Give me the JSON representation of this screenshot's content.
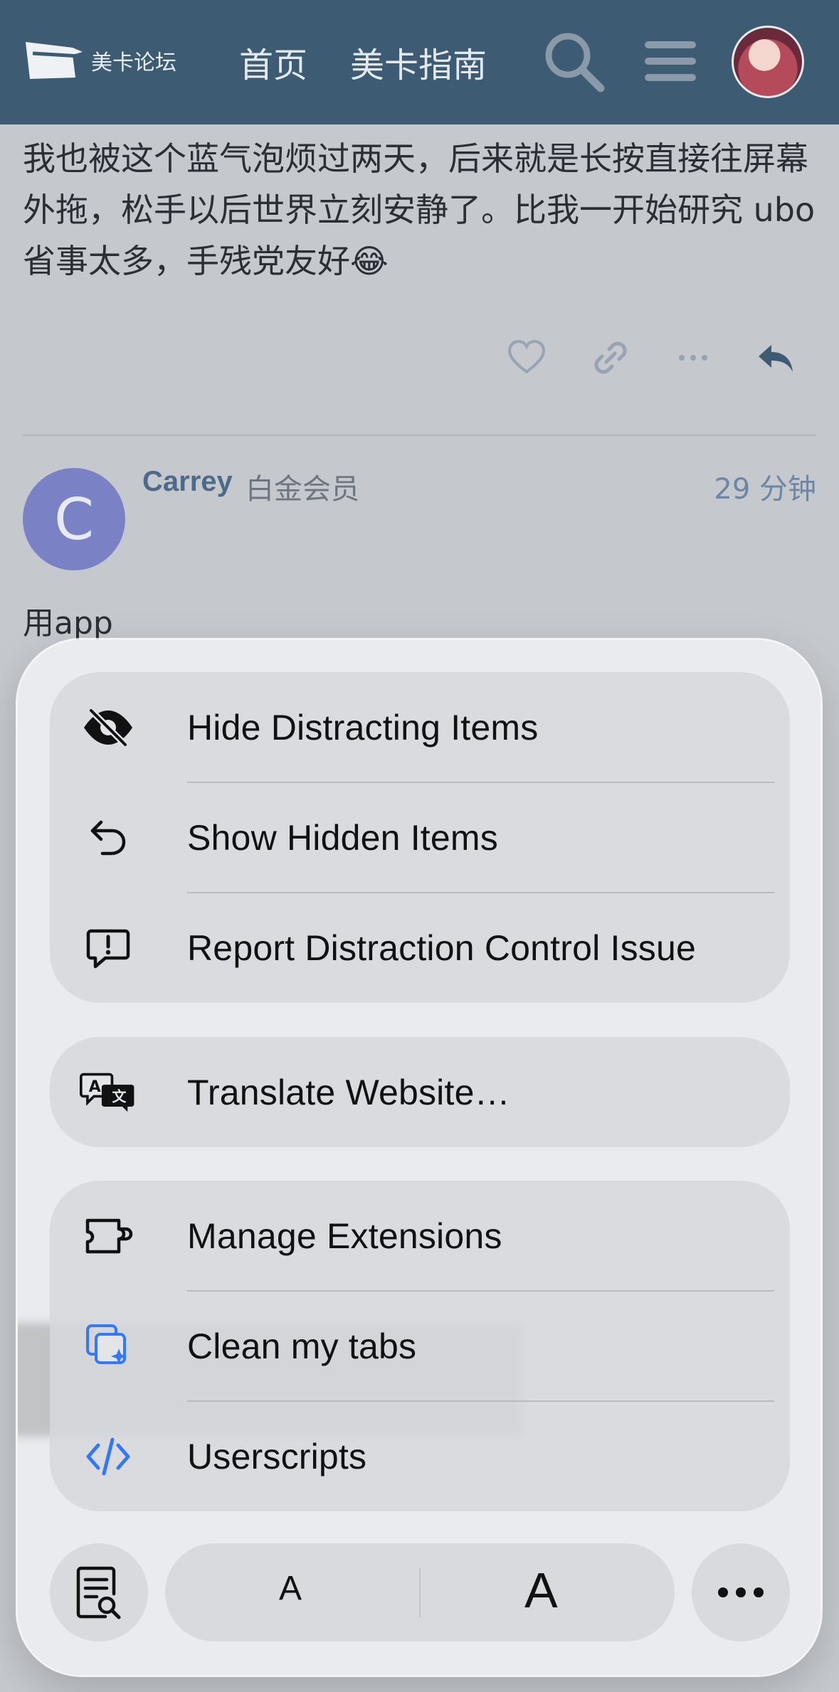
{
  "header": {
    "logo_text": "美卡论坛",
    "nav": [
      "首页",
      "美卡指南"
    ],
    "icons": [
      "search-icon",
      "hamburger-menu-icon",
      "avatar"
    ]
  },
  "post": {
    "text": "我也被这个蓝气泡烦过两天，后来就是长按直接往屏幕外拖，松手以后世界立刻安静了。比我一开始研究 ubo 省事太多，手残党友好😂",
    "actions": [
      "heart-icon",
      "link-icon",
      "more-icon",
      "reply-icon"
    ]
  },
  "reply": {
    "avatar_letter": "C",
    "user_name": "Carrey",
    "user_badge": "白金会员",
    "time": "29 分钟",
    "text": "用app"
  },
  "menu": {
    "group1": [
      {
        "label": "Hide Distracting Items",
        "icon": "eye-slash-icon"
      },
      {
        "label": "Show Hidden Items",
        "icon": "undo-arrow-icon"
      },
      {
        "label": "Report Distraction Control Issue",
        "icon": "report-bubble-icon"
      }
    ],
    "group2": [
      {
        "label": "Translate Website…",
        "icon": "translate-icon"
      }
    ],
    "group3": [
      {
        "label": "Manage Extensions",
        "icon": "extension-icon"
      },
      {
        "label": "Clean my tabs",
        "icon": "clean-tabs-icon"
      },
      {
        "label": "Userscripts",
        "icon": "code-icon"
      }
    ]
  },
  "toolbar": {
    "reader": "reader-icon",
    "font_small": "A",
    "font_large": "A",
    "more": "ellipsis-icon"
  },
  "colors": {
    "header_bg": "#3d5b73",
    "accent_blue": "#3478f6",
    "page_bg": "#c5c9ce"
  }
}
